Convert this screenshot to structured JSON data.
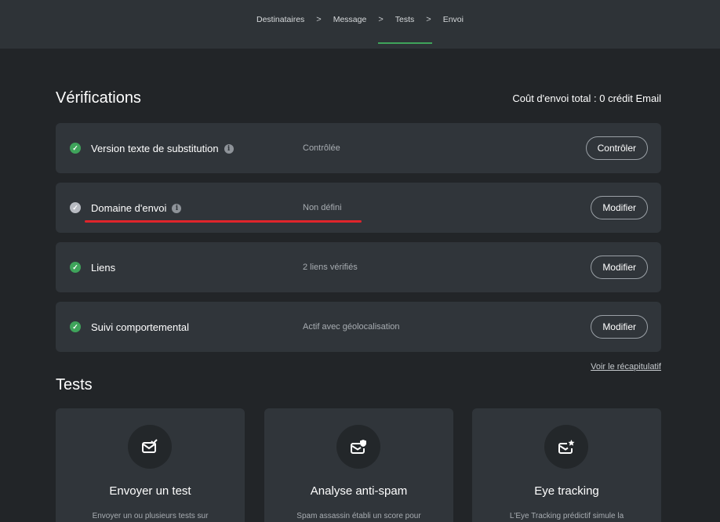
{
  "steps": [
    "Destinataires",
    "Message",
    "Tests",
    "Envoi"
  ],
  "step_separator": ">",
  "verifications": {
    "title": "Vérifications",
    "cost": "Coût d'envoi total : 0 crédit Email",
    "rows": [
      {
        "label": "Version texte de substitution",
        "status": "Contrôlée",
        "button": "Contrôler",
        "state": "ok",
        "info": true
      },
      {
        "label": "Domaine d'envoi",
        "status": "Non défini",
        "button": "Modifier",
        "state": "undefined",
        "info": true
      },
      {
        "label": "Liens",
        "status": "2 liens vérifiés",
        "button": "Modifier",
        "state": "ok",
        "info": false
      },
      {
        "label": "Suivi comportemental",
        "status": "Actif avec géolocalisation",
        "button": "Modifier",
        "state": "ok",
        "info": false
      }
    ],
    "recap_link": "Voir le récapitulatif"
  },
  "tests": {
    "title": "Tests",
    "cards": [
      {
        "title": "Envoyer un test",
        "desc": "Envoyer un ou plusieurs tests sur",
        "icon": "mail-check-icon"
      },
      {
        "title": "Analyse anti-spam",
        "desc": "Spam assassin établi un score pour",
        "icon": "mail-shield-icon"
      },
      {
        "title": "Eye tracking",
        "desc": "L'Eye Tracking prédictif simule la",
        "icon": "mail-eye-icon"
      }
    ]
  },
  "colors": {
    "accent_green": "#3fa45b",
    "highlight_red": "#e0242b"
  }
}
